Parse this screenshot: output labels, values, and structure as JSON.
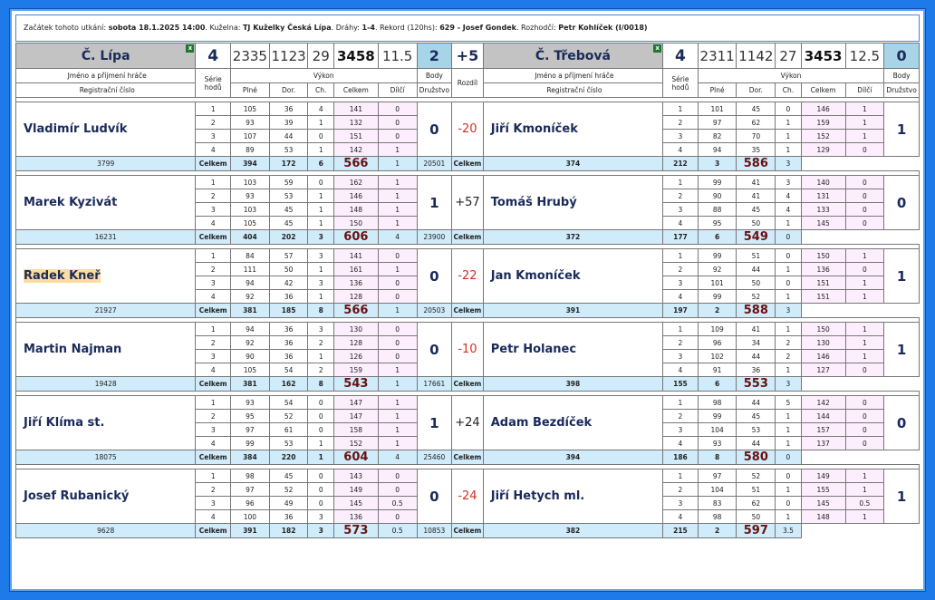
{
  "info": {
    "start_label": "Začátek tohoto utkání:",
    "start_value": "sobota 18.1.2025 14:00",
    "venue_label": ". Kuželna:",
    "venue_value": "TJ Kuželky Česká Lípa",
    "lanes_label": ". Dráhy:",
    "lanes_value": "1-4",
    "record_label": ". Rekord (120hs):",
    "record_value": "629 - Josef Gondek",
    "ref_label": ". Rozhodčí:",
    "ref_value": "Petr Kohlíček (I/0018)"
  },
  "home": {
    "name": "Č. Lípa",
    "score": "4",
    "plne": "2335",
    "dor": "1123",
    "ch": "29",
    "celkem": "3458",
    "dilci": "11.5",
    "body": "2"
  },
  "away": {
    "name": "Č. Třebová",
    "score": "4",
    "plne": "2311",
    "dor": "1142",
    "ch": "27",
    "celkem": "3453",
    "dilci": "12.5",
    "body": "0"
  },
  "rozdil_total": "+5",
  "headers": {
    "jmeno": "Jméno a příjmení hráče",
    "reg": "Registrační číslo",
    "serie": "Série hodů",
    "vykon": "Výkon",
    "body": "Body",
    "druzstvo": "Družstvo",
    "rozdil": "Rozdíl",
    "plne": "Plné",
    "dor": "Dor.",
    "ch": "Ch.",
    "celkem": "Celkem",
    "dilci": "Dílčí",
    "celkem_row": "Celkem"
  },
  "matches": [
    {
      "rozdil": "-20",
      "neg": true,
      "home": {
        "name": "Vladimír Ludvík",
        "reg": "3799",
        "body": "0",
        "series": [
          [
            "1",
            "105",
            "36",
            "4",
            "141",
            "0"
          ],
          [
            "2",
            "93",
            "39",
            "1",
            "132",
            "0"
          ],
          [
            "3",
            "107",
            "44",
            "0",
            "151",
            "0"
          ],
          [
            "4",
            "89",
            "53",
            "1",
            "142",
            "1"
          ]
        ],
        "tot": [
          "394",
          "172",
          "6",
          "566",
          "1"
        ]
      },
      "away": {
        "name": "Jiří Kmoníček",
        "reg": "20501",
        "body": "1",
        "series": [
          [
            "1",
            "101",
            "45",
            "0",
            "146",
            "1"
          ],
          [
            "2",
            "97",
            "62",
            "1",
            "159",
            "1"
          ],
          [
            "3",
            "82",
            "70",
            "1",
            "152",
            "1"
          ],
          [
            "4",
            "94",
            "35",
            "1",
            "129",
            "0"
          ]
        ],
        "tot": [
          "374",
          "212",
          "3",
          "586",
          "3"
        ]
      }
    },
    {
      "rozdil": "+57",
      "neg": false,
      "home": {
        "name": "Marek Kyzivát",
        "reg": "16231",
        "body": "1",
        "series": [
          [
            "1",
            "103",
            "59",
            "0",
            "162",
            "1"
          ],
          [
            "2",
            "93",
            "53",
            "1",
            "146",
            "1"
          ],
          [
            "3",
            "103",
            "45",
            "1",
            "148",
            "1"
          ],
          [
            "4",
            "105",
            "45",
            "1",
            "150",
            "1"
          ]
        ],
        "tot": [
          "404",
          "202",
          "3",
          "606",
          "4"
        ]
      },
      "away": {
        "name": "Tomáš Hrubý",
        "reg": "23900",
        "body": "0",
        "series": [
          [
            "1",
            "99",
            "41",
            "3",
            "140",
            "0"
          ],
          [
            "2",
            "90",
            "41",
            "4",
            "131",
            "0"
          ],
          [
            "3",
            "88",
            "45",
            "4",
            "133",
            "0"
          ],
          [
            "4",
            "95",
            "50",
            "1",
            "145",
            "0"
          ]
        ],
        "tot": [
          "372",
          "177",
          "6",
          "549",
          "0"
        ]
      }
    },
    {
      "rozdil": "-22",
      "neg": true,
      "hl": true,
      "home": {
        "name": "Radek Kneř",
        "reg": "21927",
        "body": "0",
        "series": [
          [
            "1",
            "84",
            "57",
            "3",
            "141",
            "0"
          ],
          [
            "2",
            "111",
            "50",
            "1",
            "161",
            "1"
          ],
          [
            "3",
            "94",
            "42",
            "3",
            "136",
            "0"
          ],
          [
            "4",
            "92",
            "36",
            "1",
            "128",
            "0"
          ]
        ],
        "tot": [
          "381",
          "185",
          "8",
          "566",
          "1"
        ]
      },
      "away": {
        "name": "Jan Kmoníček",
        "reg": "20503",
        "body": "1",
        "series": [
          [
            "1",
            "99",
            "51",
            "0",
            "150",
            "1"
          ],
          [
            "2",
            "92",
            "44",
            "1",
            "136",
            "0"
          ],
          [
            "3",
            "101",
            "50",
            "0",
            "151",
            "1"
          ],
          [
            "4",
            "99",
            "52",
            "1",
            "151",
            "1"
          ]
        ],
        "tot": [
          "391",
          "197",
          "2",
          "588",
          "3"
        ]
      }
    },
    {
      "rozdil": "-10",
      "neg": true,
      "home": {
        "name": "Martin Najman",
        "reg": "19428",
        "body": "0",
        "series": [
          [
            "1",
            "94",
            "36",
            "3",
            "130",
            "0"
          ],
          [
            "2",
            "92",
            "36",
            "2",
            "128",
            "0"
          ],
          [
            "3",
            "90",
            "36",
            "1",
            "126",
            "0"
          ],
          [
            "4",
            "105",
            "54",
            "2",
            "159",
            "1"
          ]
        ],
        "tot": [
          "381",
          "162",
          "8",
          "543",
          "1"
        ]
      },
      "away": {
        "name": "Petr Holanec",
        "reg": "17661",
        "body": "1",
        "series": [
          [
            "1",
            "109",
            "41",
            "1",
            "150",
            "1"
          ],
          [
            "2",
            "96",
            "34",
            "2",
            "130",
            "1"
          ],
          [
            "3",
            "102",
            "44",
            "2",
            "146",
            "1"
          ],
          [
            "4",
            "91",
            "36",
            "1",
            "127",
            "0"
          ]
        ],
        "tot": [
          "398",
          "155",
          "6",
          "553",
          "3"
        ]
      }
    },
    {
      "rozdil": "+24",
      "neg": false,
      "home": {
        "name": "Jiří Klíma st.",
        "reg": "18075",
        "body": "1",
        "series": [
          [
            "1",
            "93",
            "54",
            "0",
            "147",
            "1"
          ],
          [
            "2",
            "95",
            "52",
            "0",
            "147",
            "1"
          ],
          [
            "3",
            "97",
            "61",
            "0",
            "158",
            "1"
          ],
          [
            "4",
            "99",
            "53",
            "1",
            "152",
            "1"
          ]
        ],
        "tot": [
          "384",
          "220",
          "1",
          "604",
          "4"
        ]
      },
      "away": {
        "name": "Adam Bezdíček",
        "reg": "25460",
        "body": "0",
        "series": [
          [
            "1",
            "98",
            "44",
            "5",
            "142",
            "0"
          ],
          [
            "2",
            "99",
            "45",
            "1",
            "144",
            "0"
          ],
          [
            "3",
            "104",
            "53",
            "1",
            "157",
            "0"
          ],
          [
            "4",
            "93",
            "44",
            "1",
            "137",
            "0"
          ]
        ],
        "tot": [
          "394",
          "186",
          "8",
          "580",
          "0"
        ]
      }
    },
    {
      "rozdil": "-24",
      "neg": true,
      "home": {
        "name": "Josef Rubanický",
        "reg": "9628",
        "body": "0",
        "series": [
          [
            "1",
            "98",
            "45",
            "0",
            "143",
            "0"
          ],
          [
            "2",
            "97",
            "52",
            "0",
            "149",
            "0"
          ],
          [
            "3",
            "96",
            "49",
            "0",
            "145",
            "0.5"
          ],
          [
            "4",
            "100",
            "36",
            "3",
            "136",
            "0"
          ]
        ],
        "tot": [
          "391",
          "182",
          "3",
          "573",
          "0.5"
        ]
      },
      "away": {
        "name": "Jiří Hetych ml.",
        "reg": "10853",
        "body": "1",
        "series": [
          [
            "1",
            "97",
            "52",
            "0",
            "149",
            "1"
          ],
          [
            "2",
            "104",
            "51",
            "1",
            "155",
            "1"
          ],
          [
            "3",
            "83",
            "62",
            "0",
            "145",
            "0.5"
          ],
          [
            "4",
            "98",
            "50",
            "1",
            "148",
            "1"
          ]
        ],
        "tot": [
          "382",
          "215",
          "2",
          "597",
          "3.5"
        ]
      }
    }
  ]
}
